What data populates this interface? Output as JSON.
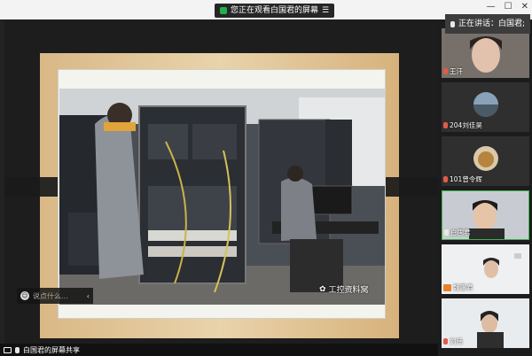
{
  "topbar": {
    "share_notice": "您正在观看白国君的屏幕",
    "menu_icon": "menu-icon"
  },
  "speaking": {
    "label": "正在讲话：白国君;"
  },
  "stage": {
    "watermark_text": "工控资料窝",
    "comment_placeholder": "说点什么..."
  },
  "participants": [
    {
      "name": "王汗",
      "muted": true
    },
    {
      "name": "204刘佳昊",
      "muted": true
    },
    {
      "name": "101曾令辉",
      "muted": true
    },
    {
      "name": "白国君",
      "muted": false
    },
    {
      "name": "魏惠君",
      "muted": true
    },
    {
      "name": "刘伟",
      "muted": true
    }
  ],
  "bottombar": {
    "label": "白国君的屏幕共享"
  },
  "colors": {
    "accent_green": "#22b14c",
    "muted_red": "#e25a4a",
    "slide_wood": "#e9d3aa"
  }
}
